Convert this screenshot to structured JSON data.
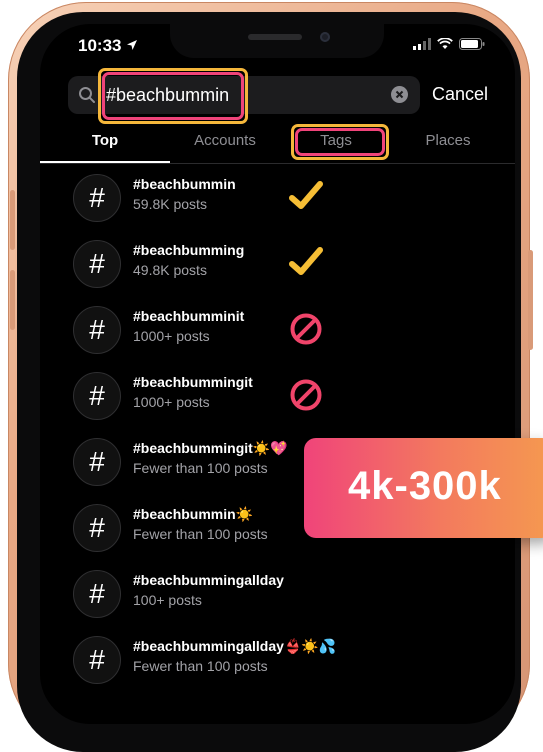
{
  "status_bar": {
    "time": "10:33"
  },
  "search": {
    "query": "#beachbummin",
    "cancel_label": "Cancel"
  },
  "tabs": [
    {
      "label": "Top",
      "active": true
    },
    {
      "label": "Accounts",
      "active": false
    },
    {
      "label": "Tags",
      "active": false
    },
    {
      "label": "Places",
      "active": false
    }
  ],
  "results": [
    {
      "name": "#beachbummin",
      "count": "59.8K posts",
      "status_icon": "checkmark-icon"
    },
    {
      "name": "#beachbumming",
      "count": "49.8K posts",
      "status_icon": "checkmark-icon"
    },
    {
      "name": "#beachbumminit",
      "count": "1000+ posts",
      "status_icon": "prohibited-icon"
    },
    {
      "name": "#beachbummingit",
      "count": "1000+ posts",
      "status_icon": "prohibited-icon"
    },
    {
      "name": "#beachbummingit",
      "emoji": "☀️💖",
      "count": "Fewer than 100 posts"
    },
    {
      "name": "#beachbummin",
      "emoji": "☀️",
      "count": "Fewer than 100 posts"
    },
    {
      "name": "#beachbummingallday",
      "count": "100+ posts"
    },
    {
      "name": "#beachbummingallday",
      "emoji": "👙☀️💦",
      "count": "Fewer than 100 posts"
    }
  ],
  "overlay": {
    "range_label": "4k-300k"
  },
  "colors": {
    "highlight_outer": "#f0447a",
    "highlight_inner": "#f5b73b",
    "check": "#f6be35",
    "prohibited": "#f0446a",
    "badge_start": "#f0447a",
    "badge_end": "#f59a4f"
  }
}
